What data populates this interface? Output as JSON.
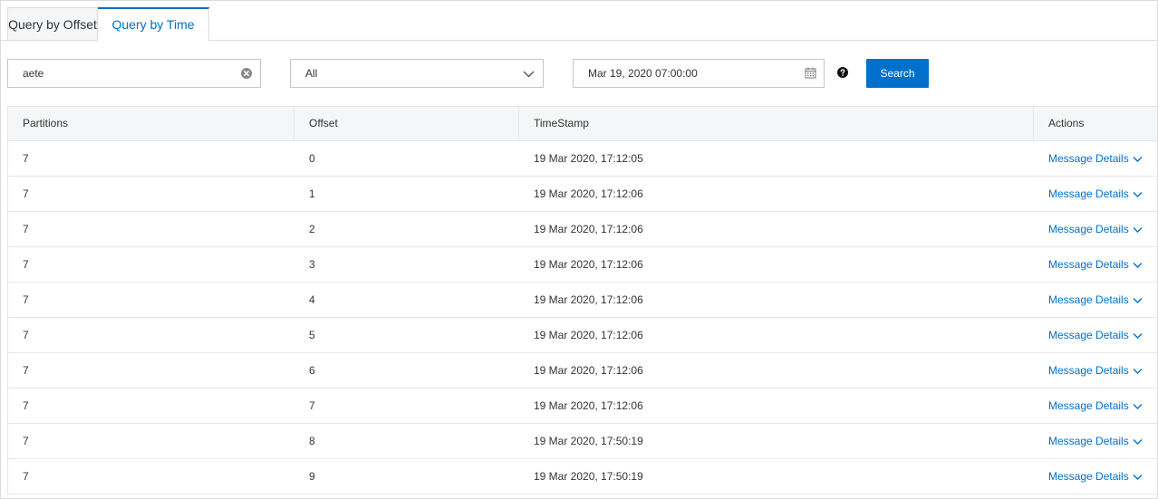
{
  "tabs": [
    {
      "label": "Query by Offset",
      "active": false
    },
    {
      "label": "Query by Time",
      "active": true
    }
  ],
  "filters": {
    "search_value": "aete",
    "clear_icon": "clear-circle-icon",
    "partition_select": "All",
    "datetime_value": "Mar 19, 2020 07:00:00",
    "calendar_icon": "calendar-icon",
    "help_icon": "question-circle-icon",
    "search_label": "Search"
  },
  "colors": {
    "accent": "#0070cc",
    "header_bg": "#f5f6f7",
    "border": "#e6e7eb"
  },
  "table": {
    "columns": [
      "Partitions",
      "Offset",
      "TimeStamp",
      "Actions"
    ],
    "rows": [
      {
        "partition": "7",
        "offset": "0",
        "timestamp": "19 Mar 2020, 17:12:05",
        "action": "Message Details"
      },
      {
        "partition": "7",
        "offset": "1",
        "timestamp": "19 Mar 2020, 17:12:06",
        "action": "Message Details"
      },
      {
        "partition": "7",
        "offset": "2",
        "timestamp": "19 Mar 2020, 17:12:06",
        "action": "Message Details"
      },
      {
        "partition": "7",
        "offset": "3",
        "timestamp": "19 Mar 2020, 17:12:06",
        "action": "Message Details"
      },
      {
        "partition": "7",
        "offset": "4",
        "timestamp": "19 Mar 2020, 17:12:06",
        "action": "Message Details"
      },
      {
        "partition": "7",
        "offset": "5",
        "timestamp": "19 Mar 2020, 17:12:06",
        "action": "Message Details"
      },
      {
        "partition": "7",
        "offset": "6",
        "timestamp": "19 Mar 2020, 17:12:06",
        "action": "Message Details"
      },
      {
        "partition": "7",
        "offset": "7",
        "timestamp": "19 Mar 2020, 17:12:06",
        "action": "Message Details"
      },
      {
        "partition": "7",
        "offset": "8",
        "timestamp": "19 Mar 2020, 17:50:19",
        "action": "Message Details"
      },
      {
        "partition": "7",
        "offset": "9",
        "timestamp": "19 Mar 2020, 17:50:19",
        "action": "Message Details"
      }
    ]
  }
}
